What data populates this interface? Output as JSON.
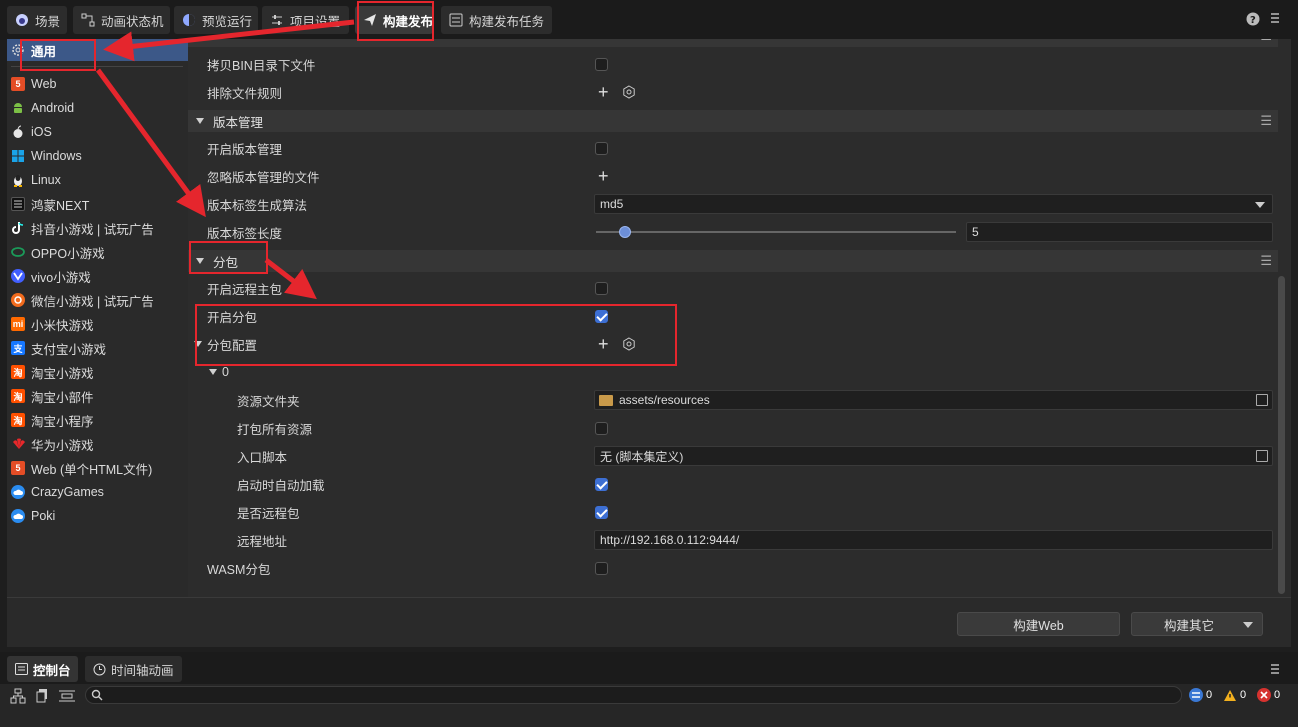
{
  "top_tabs": [
    {
      "label": "场景",
      "icon": "scene-icon"
    },
    {
      "label": "动画状态机",
      "icon": "state-machine-icon"
    },
    {
      "label": "预览运行",
      "icon": "preview-icon"
    },
    {
      "label": "项目设置",
      "icon": "settings-sliders-icon"
    },
    {
      "label": "构建发布",
      "icon": "paper-plane-icon"
    },
    {
      "label": "构建发布任务",
      "icon": "task-list-icon"
    }
  ],
  "sidebar": {
    "items": [
      {
        "label": "通用"
      },
      {
        "label": "Web"
      },
      {
        "label": "Android"
      },
      {
        "label": "iOS"
      },
      {
        "label": "Windows"
      },
      {
        "label": "Linux"
      },
      {
        "label": "鸿蒙NEXT"
      },
      {
        "label": "抖音小游戏 | 试玩广告"
      },
      {
        "label": "OPPO小游戏"
      },
      {
        "label": "vivo小游戏"
      },
      {
        "label": "微信小游戏 | 试玩广告"
      },
      {
        "label": "小米快游戏"
      },
      {
        "label": "支付宝小游戏"
      },
      {
        "label": "淘宝小游戏"
      },
      {
        "label": "淘宝小部件"
      },
      {
        "label": "淘宝小程序"
      },
      {
        "label": "华为小游戏"
      },
      {
        "label": "Web (单个HTML文件)"
      },
      {
        "label": "CrazyGames"
      },
      {
        "label": "Poki"
      }
    ]
  },
  "settings": {
    "copy_bin": {
      "label": "拷贝BIN目录下文件",
      "checked": false
    },
    "exclude_rules": {
      "label": "排除文件规则"
    },
    "version_section": {
      "title": "版本管理"
    },
    "enable_version": {
      "label": "开启版本管理",
      "checked": false
    },
    "ignore_version_files": {
      "label": "忽略版本管理的文件"
    },
    "hash_algo": {
      "label": "版本标签生成算法",
      "value": "md5"
    },
    "hash_length": {
      "label": "版本标签长度",
      "value": "5",
      "fraction": 0.08
    },
    "subpkg_section": {
      "title": "分包"
    },
    "remote_main": {
      "label": "开启远程主包",
      "checked": false
    },
    "enable_subpkg": {
      "label": "开启分包",
      "checked": true
    },
    "subpkg_config": {
      "label": "分包配置"
    },
    "entry0": {
      "index": "0",
      "res_folder": {
        "label": "资源文件夹",
        "value": "assets/resources"
      },
      "pack_all": {
        "label": "打包所有资源",
        "checked": false
      },
      "entry_script": {
        "label": "入口脚本",
        "value": "无 (脚本集定义)"
      },
      "auto_load": {
        "label": "启动时自动加载",
        "checked": true
      },
      "is_remote": {
        "label": "是否远程包",
        "checked": true
      },
      "remote_url": {
        "label": "远程地址",
        "value": "http://192.168.0.112:9444/"
      }
    },
    "wasm_subpkg": {
      "label": "WASM分包",
      "checked": false
    }
  },
  "actions": {
    "build_web": "构建Web",
    "build_other": "构建其它"
  },
  "console": {
    "tabs": [
      "控制台",
      "时间轴动画"
    ],
    "counts": {
      "info": "0",
      "warn": "0",
      "error": "0"
    }
  },
  "colors": {
    "accent": "#3d6fd3",
    "selected": "#3c5888",
    "annotation": "#e5262d"
  }
}
